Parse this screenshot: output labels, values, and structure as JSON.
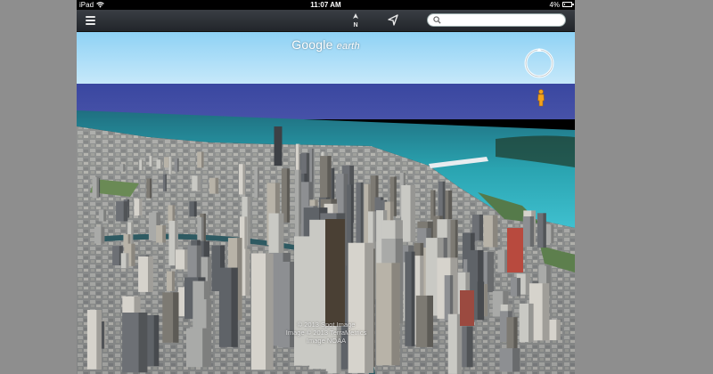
{
  "status_bar": {
    "carrier": "iPad",
    "time": "11:07 AM",
    "battery_percent": "4%",
    "battery_level": 0.04
  },
  "toolbar": {
    "compass_label": "N",
    "search_placeholder": ""
  },
  "map": {
    "logo_main": "Google",
    "logo_suffix": "earth",
    "attribution": [
      "© 2013 Spot Image",
      "Image © 2013 TerraMetrics",
      "Image NOAA"
    ]
  },
  "colors": {
    "toolbar_bg": "#2c3036",
    "sky": "#a8ddf7",
    "lake": "#2fa7b4",
    "pegman": "#f3a21b"
  },
  "icons": [
    "menu-icon",
    "compass-north-icon",
    "location-arrow-icon",
    "search-icon",
    "navigation-ring-icon",
    "pegman-icon"
  ]
}
